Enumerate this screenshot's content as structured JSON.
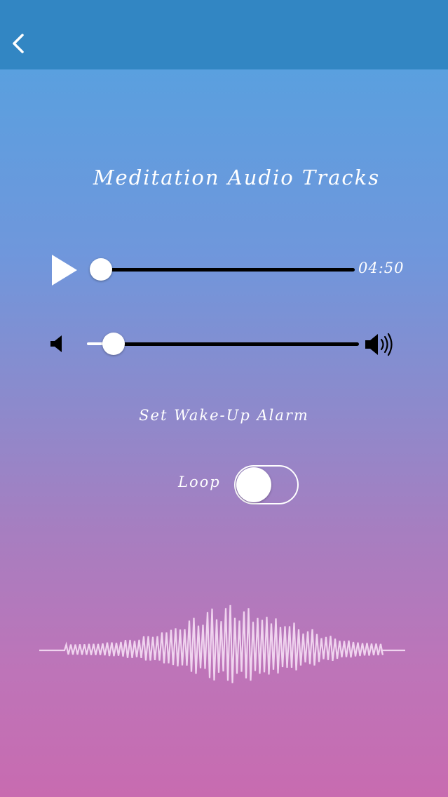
{
  "header": {
    "back_icon": "chevron-left-icon",
    "background_color": "#3286c3"
  },
  "title": "Meditation Audio Tracks",
  "player": {
    "play_icon": "play-icon",
    "progress": 0.0,
    "duration": "04:50"
  },
  "volume": {
    "low_icon": "volume-low-icon",
    "high_icon": "volume-high-icon",
    "level": 0.1
  },
  "alarm_label": "Set Wake-Up Alarm",
  "loop": {
    "label": "Loop",
    "enabled": false
  },
  "waveform_icon": "sound-wave-icon",
  "colors": {
    "gradient_top": "#52a3e0",
    "gradient_bottom": "#c86bb0",
    "track": "#000000",
    "accent": "#ffffff"
  }
}
